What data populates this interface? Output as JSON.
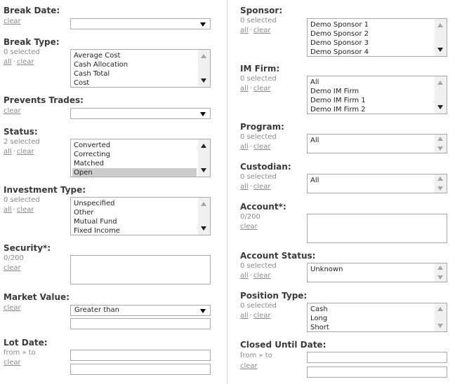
{
  "labels": {
    "clear": "clear",
    "all": "all",
    "dot": "·",
    "zero_selected": "0 selected",
    "two_selected": "2 selected",
    "count_0_200": "0/200",
    "from_to": "from » to"
  },
  "left": {
    "break_date": {
      "title": "Break Date:",
      "value": ""
    },
    "break_type": {
      "title": "Break Type:",
      "items": [
        "Average Cost",
        "Cash Allocation",
        "Cash Total",
        "Cost"
      ]
    },
    "prevents_trades": {
      "title": "Prevents Trades:",
      "value": ""
    },
    "status": {
      "title": "Status:",
      "items": [
        "Converted",
        "Correcting",
        "Matched",
        "Open"
      ]
    },
    "investment_type": {
      "title": "Investment Type:",
      "items": [
        "Unspecified",
        "Other",
        "Mutual Fund",
        "Fixed Income"
      ]
    },
    "security": {
      "title": "Security*:"
    },
    "market_value": {
      "title": "Market Value:",
      "operator": "Greater than"
    },
    "lot_date": {
      "title": "Lot Date:"
    }
  },
  "right": {
    "sponsor": {
      "title": "Sponsor:",
      "items": [
        "Demo Sponsor 1",
        "Demo Sponsor 2",
        "Demo Sponsor 3",
        "Demo Sponsor 4"
      ]
    },
    "im_firm": {
      "title": "IM Firm:",
      "items": [
        "All",
        "Demo IM Firm",
        "Demo IM Firm 1",
        "Demo IM Firm 2"
      ]
    },
    "program": {
      "title": "Program:",
      "items": [
        "All"
      ]
    },
    "custodian": {
      "title": "Custodian:",
      "items": [
        "All"
      ]
    },
    "account": {
      "title": "Account*:"
    },
    "account_status": {
      "title": "Account Status:",
      "items": [
        "Unknown"
      ]
    },
    "position_type": {
      "title": "Position Type:",
      "items": [
        "Cash",
        "Long",
        "Short"
      ]
    },
    "closed_until_date": {
      "title": "Closed Until Date:"
    }
  }
}
